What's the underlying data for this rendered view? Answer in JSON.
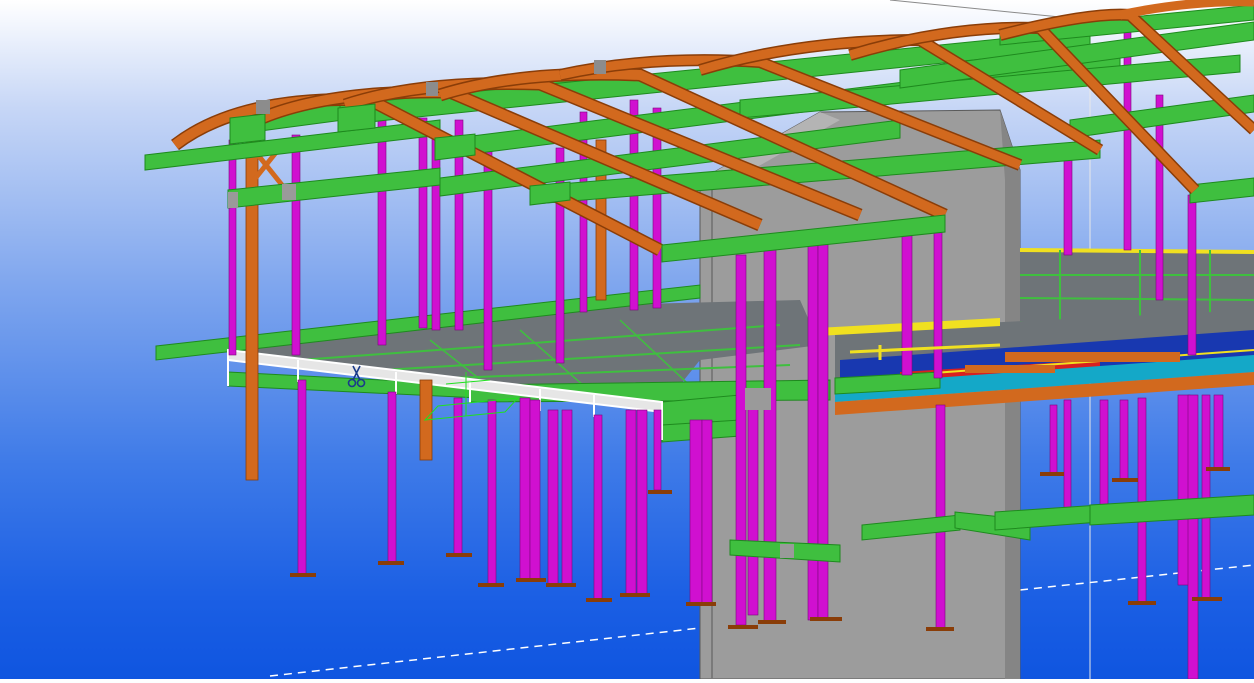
{
  "viewport": {
    "kind": "3D structural steel model view",
    "cursor_icon": "scissors-cursor-icon",
    "colors": {
      "sky_top": "#ffffff",
      "sky_bottom": "#0f55e0",
      "purlin_green": "#3fbf3f",
      "purlin_edge": "#1e8a1e",
      "rafter_orange": "#d2691e",
      "rafter_edge": "#8a3d08",
      "column_magenta": "#d010d0",
      "column_edge": "#7a087a",
      "core_wall_gray": "#9a9a9a",
      "floor_slab_gray": "#6e7478",
      "edge_beam_yellow": "#f0e020",
      "deck_cyan": "#14a8c8",
      "deck_blue": "#1838b0",
      "deck_red": "#d82020",
      "selection_white": "#ffffff",
      "gridline_white": "#ffffff"
    }
  }
}
